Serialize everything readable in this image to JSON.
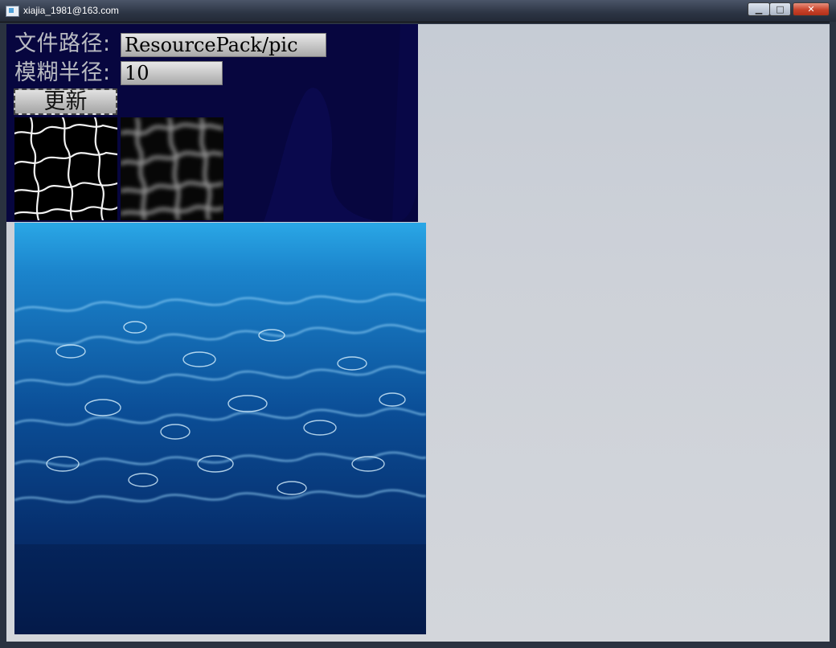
{
  "window": {
    "title": "xiajia_1981@163.com",
    "buttons": {
      "minimize": "▁",
      "maximize": "□",
      "close": "✕"
    }
  },
  "form": {
    "path_label": "文件路径:",
    "path_value": "ResourcePack/pic",
    "radius_label": "模糊半径:",
    "radius_value": "10",
    "update_button": "更新"
  },
  "colors": {
    "panel": "#07063f",
    "background": "#cdd1d8",
    "water_light": "#29a8e8",
    "water_dark": "#041a4a"
  },
  "icons": {
    "app": "app-window-icon"
  }
}
